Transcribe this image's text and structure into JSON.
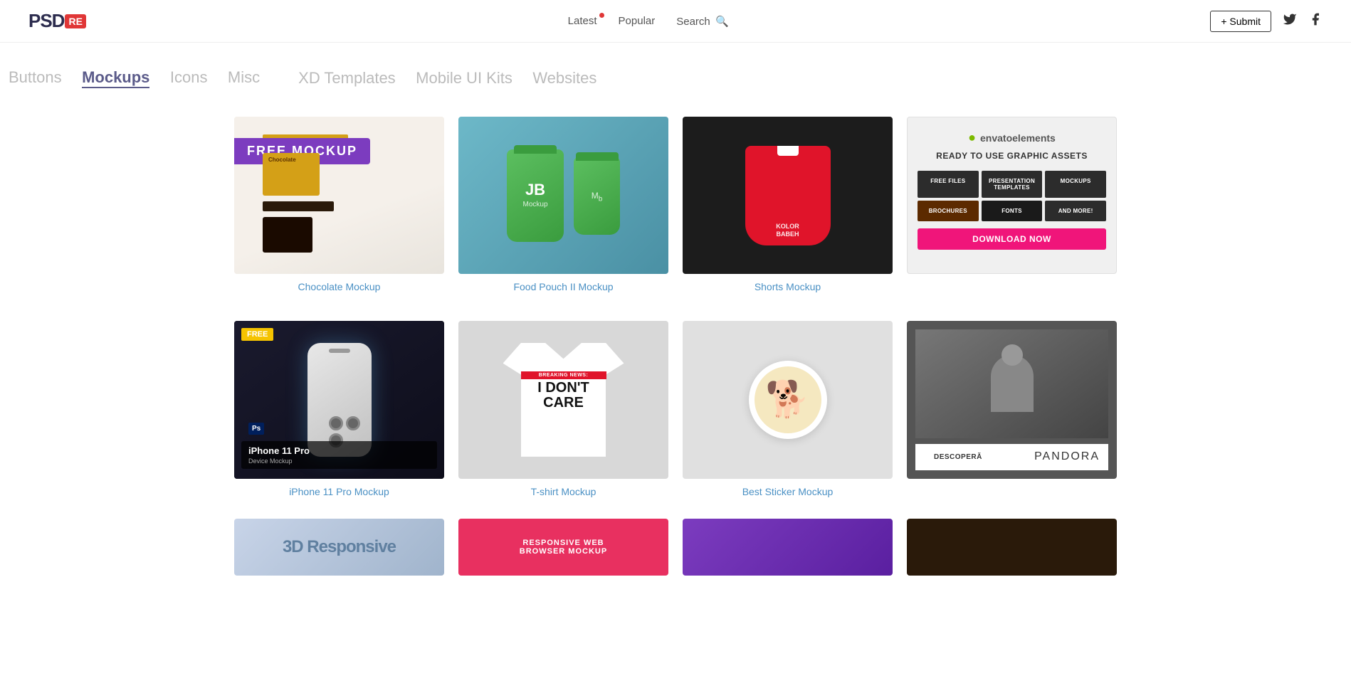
{
  "header": {
    "logo_psd": "PSD",
    "logo_re": "RE",
    "nav": {
      "latest": "Latest",
      "popular": "Popular",
      "search": "Search",
      "submit": "+ Submit"
    },
    "social": {
      "twitter": "𝕏",
      "facebook": "f"
    }
  },
  "category_nav": {
    "row1": [
      {
        "label": "Buttons",
        "active": false
      },
      {
        "label": "Mockups",
        "active": true
      },
      {
        "label": "Icons",
        "active": false
      },
      {
        "label": "Misc",
        "active": false
      }
    ],
    "row2": [
      {
        "label": "XD Templates",
        "active": false
      },
      {
        "label": "Mobile UI Kits",
        "active": false
      },
      {
        "label": "Websites",
        "active": false
      }
    ]
  },
  "grid": {
    "row1": [
      {
        "id": "chocolate",
        "badge": "FREE MOCKUP",
        "title": "Chocolate Mockup",
        "title_color": "#4a90c4"
      },
      {
        "id": "food-pouch",
        "badge": null,
        "title": "Food Pouch II Mockup",
        "title_color": "#4a90c4",
        "title_highlight": "II"
      },
      {
        "id": "shorts",
        "badge": null,
        "title": "Shorts Mockup",
        "title_color": "#4a90c4"
      },
      {
        "id": "envato-ad",
        "type": "ad",
        "envato_label": "envatoelements",
        "headline": "READY TO USE GRAPHIC ASSETS",
        "assets": [
          "FREE FILES",
          "PRESENTATION TEMPLATES",
          "MOCKUPS",
          "BROCHURES",
          "FONTS",
          "AND MORE!"
        ],
        "download_btn": "DOWNLOAD NOW"
      }
    ],
    "row2": [
      {
        "id": "iphone",
        "badge": "FREE",
        "title": "iPhone 11 Pro Mockup",
        "title_color": "#4a90c4",
        "label": "iPhone 11 Pro",
        "sublabel": "Device Mockup"
      },
      {
        "id": "tshirt",
        "badge": null,
        "title": "T-shirt Mockup",
        "title_color": "#4a90c4",
        "breaking": "BREAKING NEWS:",
        "dont_care": "I DON'T\nCARE"
      },
      {
        "id": "sticker",
        "badge": null,
        "title": "Best Sticker Mockup",
        "title_color": "#4a90c4"
      },
      {
        "id": "pandora-ad",
        "type": "ad",
        "btn_label": "DESCOPERĂ",
        "brand": "PANDORA"
      }
    ],
    "row3_partial": [
      {
        "id": "3d-responsive",
        "text": "3D Responsive"
      },
      {
        "id": "browser-mockup",
        "text": "RESPONSIVE WEB\nBROWSER MOCKUP"
      },
      {
        "id": "purple-card",
        "text": ""
      },
      {
        "id": "dark-card",
        "text": ""
      }
    ]
  },
  "colors": {
    "accent_blue": "#4a90c4",
    "accent_red": "#e03737",
    "accent_purple": "#7c3cbf",
    "accent_yellow": "#f5c300",
    "envato_green": "#7cba00",
    "pandora_pink": "#f0157a"
  }
}
